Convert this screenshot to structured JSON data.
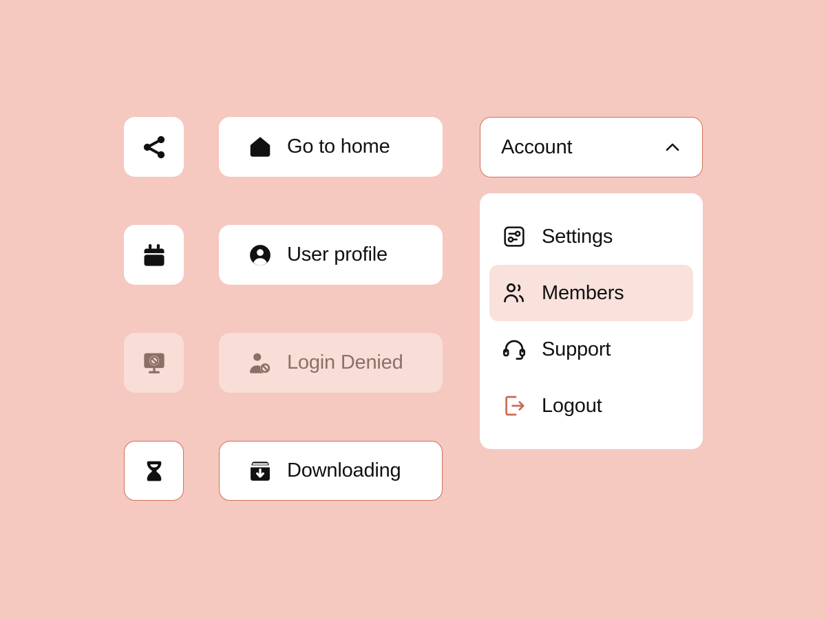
{
  "theme": {
    "background": "#f5c8c0",
    "surface": "#ffffff",
    "accent": "#d0705a",
    "disabled_surface": "#f9ddd7",
    "disabled_text": "#8c7068",
    "highlight": "#f9e1dc",
    "text": "#111111"
  },
  "icon_buttons": [
    {
      "name": "share-icon",
      "state": "default"
    },
    {
      "name": "calendar-icon",
      "state": "default"
    },
    {
      "name": "screen-share-off-icon",
      "state": "disabled"
    },
    {
      "name": "hourglass-icon",
      "state": "outlined"
    }
  ],
  "label_buttons": [
    {
      "label": "Go to home",
      "icon": "home-icon",
      "state": "default"
    },
    {
      "label": "User profile",
      "icon": "user-circle-icon",
      "state": "default"
    },
    {
      "label": "Login Denied",
      "icon": "user-denied-icon",
      "state": "disabled"
    },
    {
      "label": "Downloading",
      "icon": "package-down-icon",
      "state": "outlined"
    }
  ],
  "account": {
    "trigger_label": "Account",
    "chevron_icon": "chevron-up-icon",
    "expanded": true,
    "menu": [
      {
        "label": "Settings",
        "icon": "sliders-box-icon",
        "active": false
      },
      {
        "label": "Members",
        "icon": "users-icon",
        "active": true
      },
      {
        "label": "Support",
        "icon": "headset-icon",
        "active": false
      },
      {
        "label": "Logout",
        "icon": "logout-icon",
        "active": false
      }
    ]
  }
}
